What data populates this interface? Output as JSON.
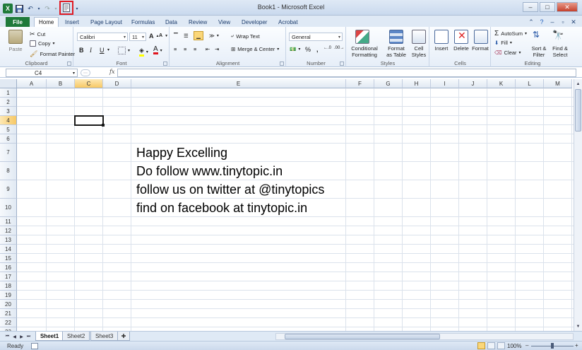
{
  "window": {
    "title": "Book1 - Microsoft Excel",
    "controls": [
      "–",
      "□",
      "✕"
    ]
  },
  "quick_access": [
    "save-icon",
    "undo-icon",
    "redo-icon",
    "print-preview-icon"
  ],
  "ribbon_tabs": [
    "File",
    "Home",
    "Insert",
    "Page Layout",
    "Formulas",
    "Data",
    "Review",
    "View",
    "Developer",
    "Acrobat"
  ],
  "active_tab": "Home",
  "clipboard": {
    "paste": "Paste",
    "cut": "Cut",
    "copy": "Copy",
    "format_painter": "Format Painter",
    "label": "Clipboard"
  },
  "font": {
    "name": "Calibri",
    "size": "11",
    "bold": "B",
    "italic": "I",
    "underline": "U",
    "grow": "A",
    "shrink": "A",
    "label": "Font"
  },
  "alignment": {
    "wrap_text": "Wrap Text",
    "merge_center": "Merge & Center",
    "label": "Alignment"
  },
  "number": {
    "format": "General",
    "percent": "%",
    "comma": ",",
    "label": "Number"
  },
  "styles": {
    "conditional": "Conditional\nFormatting",
    "format_table": "Format\nas Table",
    "cell_styles": "Cell\nStyles",
    "label": "Styles"
  },
  "cells": {
    "insert": "Insert",
    "delete": "Delete",
    "format": "Format",
    "label": "Cells"
  },
  "editing": {
    "autosum": "AutoSum",
    "fill": "Fill",
    "clear": "Clear",
    "sort_filter": "Sort &\nFilter",
    "find_select": "Find &\nSelect",
    "label": "Editing"
  },
  "formula_bar": {
    "name_box": "C4",
    "fx": "fx",
    "content": ""
  },
  "columns": [
    "A",
    "B",
    "C",
    "D",
    "E",
    "F",
    "G",
    "H",
    "I",
    "J",
    "K",
    "L",
    "M"
  ],
  "selected_column": "C",
  "rows": [
    "1",
    "2",
    "3",
    "4",
    "5",
    "6",
    "7",
    "8",
    "9",
    "10",
    "11",
    "12",
    "13",
    "14",
    "15",
    "16",
    "17",
    "18",
    "19",
    "20",
    "21",
    "22",
    "23"
  ],
  "selected_row": "4",
  "cells_text": {
    "r7": "Happy Excelling",
    "r8": "Do follow www.tinytopic.in",
    "r9": "follow us on twitter at @tinytopics",
    "r10": "find on facebook at tinytopic.in"
  },
  "sheets": [
    "Sheet1",
    "Sheet2",
    "Sheet3"
  ],
  "active_sheet": "Sheet1",
  "status": {
    "ready": "Ready",
    "zoom": "100%",
    "minus": "–",
    "plus": "+"
  },
  "colors": {
    "file_tab": "#1f7a3a",
    "selection_header": "#f7c864",
    "highlight_box": "#e01b24"
  }
}
